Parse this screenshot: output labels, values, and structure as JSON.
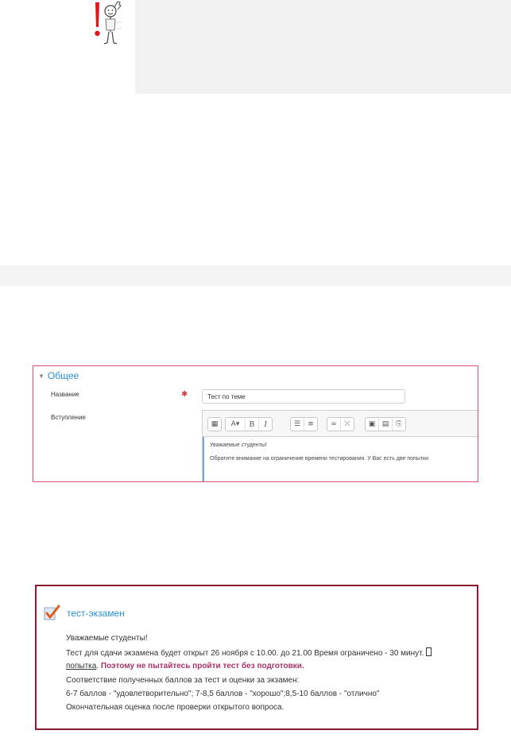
{
  "form": {
    "section_title": "Общее",
    "name_label": "Название",
    "intro_label": "Вступление",
    "name_value": "Тест по теме",
    "editor_lines": [
      "Уважаемые студенты!",
      "Обратите внимание на ограничение времени тестирования. У Вас есть две попытки"
    ],
    "toolbar_icons": [
      "toolbar-toggle-icon",
      "font-style-icon",
      "bold-icon",
      "italic-icon",
      "bullet-list-icon",
      "numbered-list-icon",
      "link-icon",
      "unlink-icon",
      "image-icon",
      "media-icon",
      "paste-icon"
    ]
  },
  "preview": {
    "title": "тест-экзамен",
    "greeting": "Уважаемые студенты!",
    "schedule": "Тест для сдачи экзамена будет открыт 26 ноября с 10.00. до 21.00 Время ограничено - 30 минут.",
    "attempt_link": "попытка",
    "warning": "Поэтому не пытайтесь пройти тест без подготовки.",
    "grading_intro": "Соответствие полученных баллов за тест и оценки за экзамен:",
    "grading_scale": "6-7 баллов - \"удовлетворительно\"; 7-8,5 баллов - \"хорошо\";8,5-10 баллов - \"отлично\"",
    "final_note": "Окончательная оценка после проверки открытого вопроса."
  },
  "colors": {
    "form_border": "#d4556a",
    "preview_border": "#8b1c2f",
    "link_blue": "#2a8fd6",
    "warning_text": "#a8336a",
    "required_red": "#d04040"
  }
}
